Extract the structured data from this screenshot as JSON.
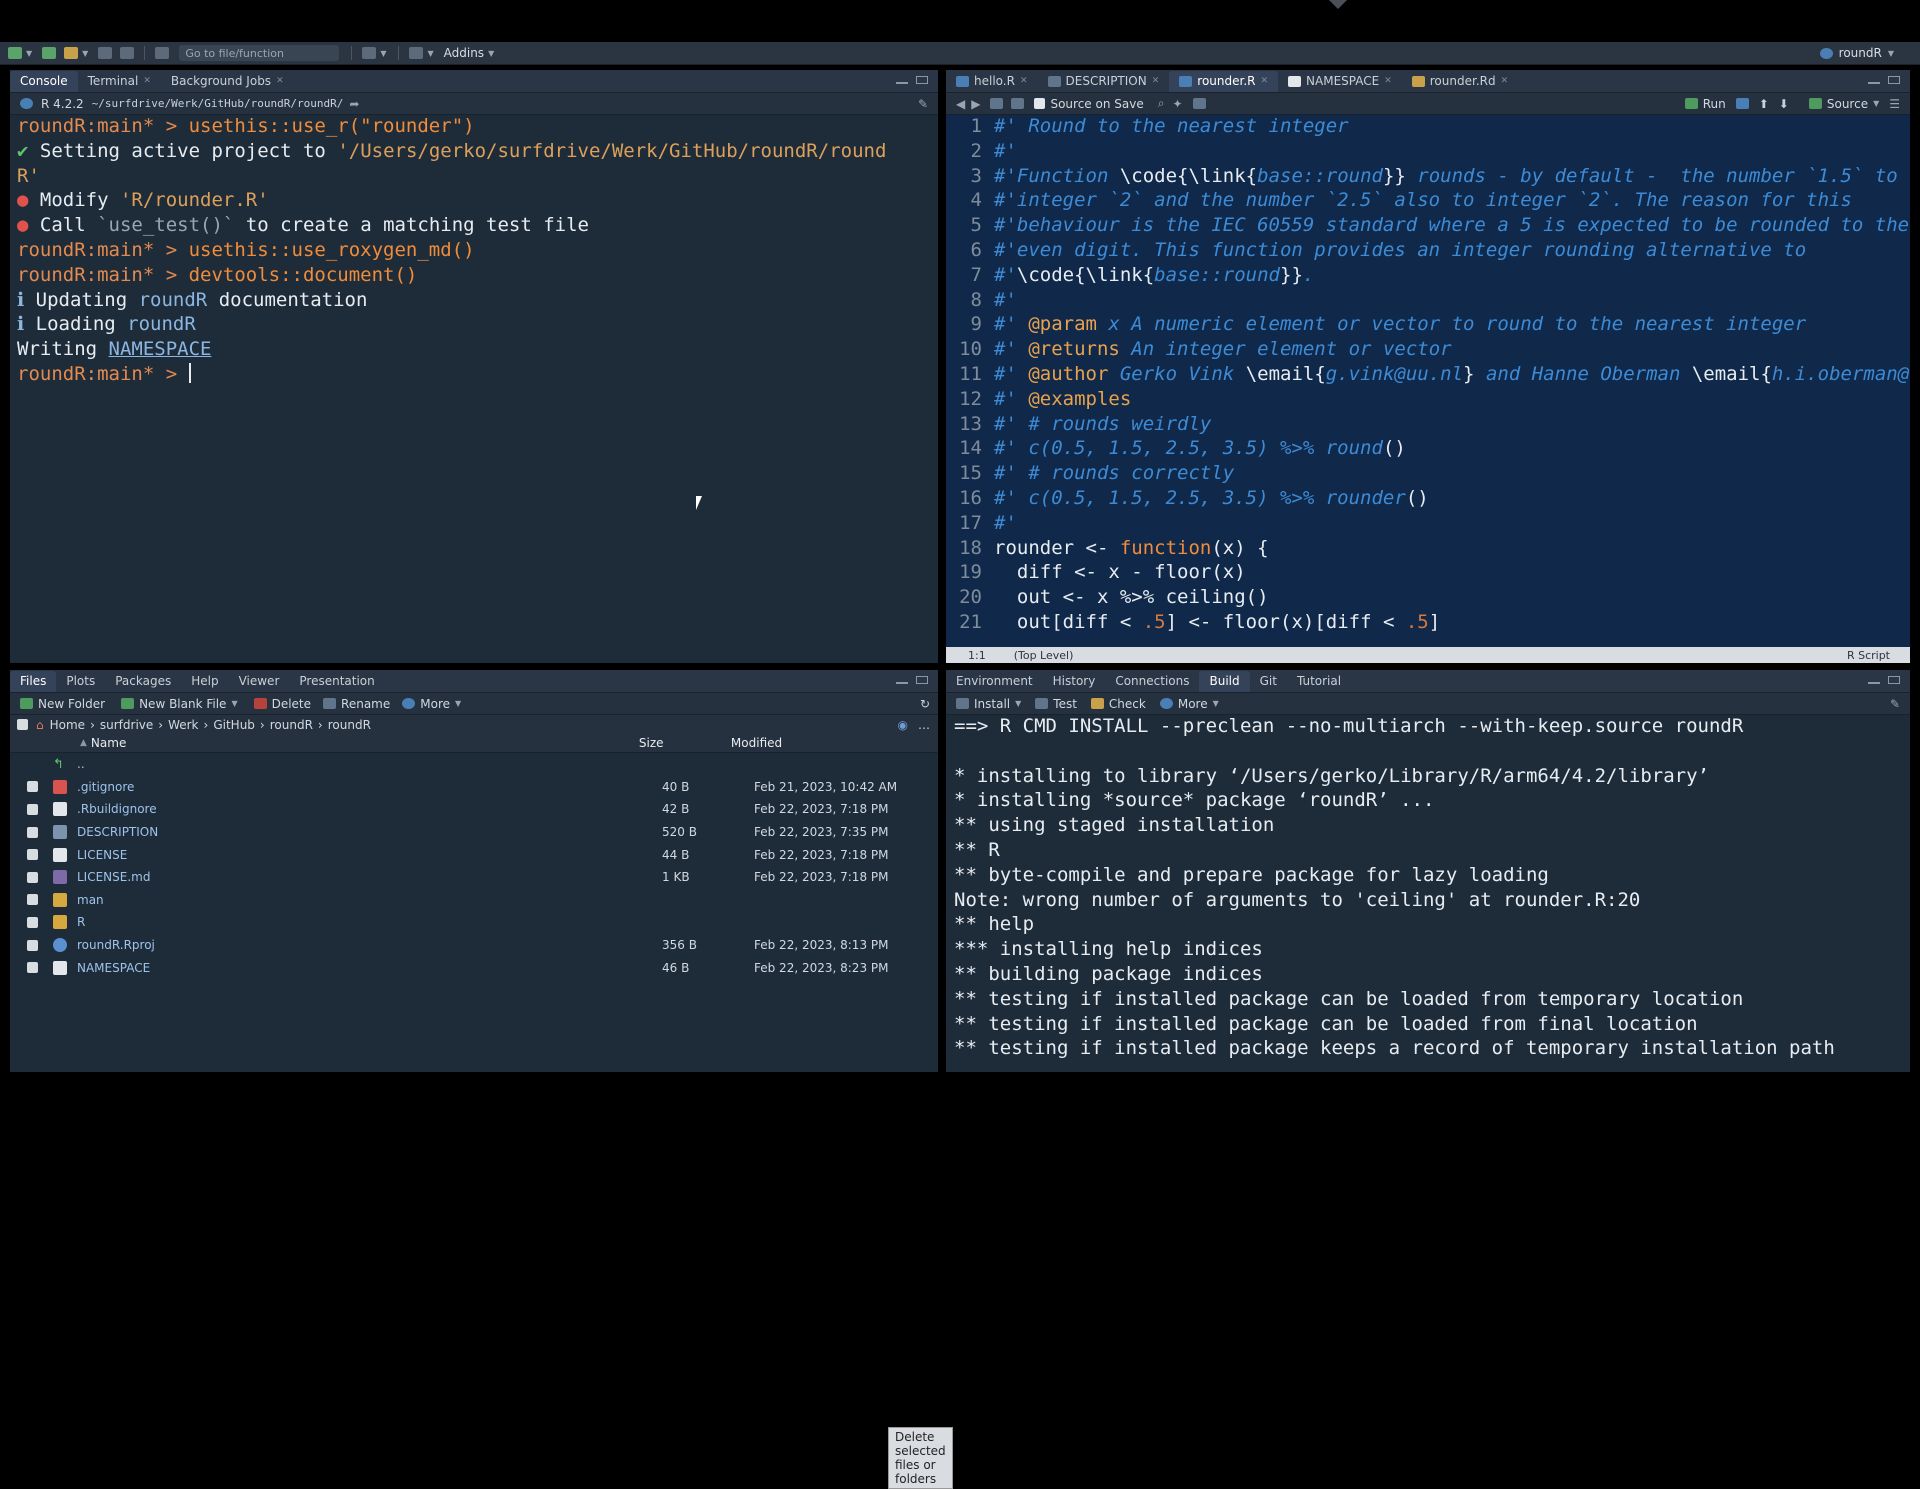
{
  "toolbar": {
    "goto_placeholder": "Go to file/function",
    "addins": "Addins",
    "project": "roundR"
  },
  "console": {
    "tabs": [
      "Console",
      "Terminal",
      "Background Jobs"
    ],
    "r_version": "R 4.2.2",
    "path": "~/surfdrive/Werk/GitHub/roundR/roundR/",
    "lines": {
      "l1_prompt": "roundR:main* > ",
      "l1_cmd": "usethis::use_r(\"rounder\")",
      "l2_mark": "✔",
      "l2_text": " Setting active project to ",
      "l2_path": "'/Users/gerko/surfdrive/Werk/GitHub/roundR/round",
      "l3_path": "R'",
      "l4_mark": "●",
      "l4_text": " Modify ",
      "l4_path": "'R/rounder.R'",
      "l5_mark": "●",
      "l5_text1": " Call ",
      "l5_code": "`use_test()`",
      "l5_text2": " to create a matching test file",
      "l6_prompt": "roundR:main* > ",
      "l6_cmd": "usethis::use_roxygen_md()",
      "l7_prompt": "roundR:main* > ",
      "l7_cmd": "devtools::document()",
      "l8_mark": "ℹ",
      "l8_text1": " Updating ",
      "l8_pkg": "roundR",
      "l8_text2": " documentation",
      "l9_mark": "ℹ",
      "l9_text1": " Loading ",
      "l9_pkg": "roundR",
      "l10_text": "Writing ",
      "l10_link": "NAMESPACE",
      "l11_prompt": "roundR:main* > "
    }
  },
  "editor": {
    "tabs": [
      "hello.R",
      "DESCRIPTION",
      "rounder.R",
      "NAMESPACE",
      "rounder.Rd"
    ],
    "toolbar": {
      "source_on_save": "Source on Save",
      "run": "Run",
      "source": "Source"
    },
    "status": {
      "pos": "1:1",
      "scope": "(Top Level)",
      "type": "R Script"
    },
    "lines": {
      "n": [
        "1",
        "2",
        "3",
        "4",
        "5",
        "6",
        "7",
        "8",
        "9",
        "10",
        "11",
        "12",
        "13",
        "14",
        "15",
        "16",
        "17",
        "18",
        "19",
        "20",
        "21"
      ],
      "l1": "#' Round to the nearest integer",
      "l2": "#'",
      "l3a": "#'Function ",
      "l3b": "\\code{\\link{",
      "l3c": "base::round",
      "l3d": "}}",
      "l3e": " rounds - by default -  the number `1.5` to",
      "l4": "#'integer `2` and the number `2.5` also to integer `2`. The reason for this",
      "l5": "#'behaviour is the IEC 60559 standard where a 5 is expected to be rounded to the",
      "l6": "#'even digit. This function provides an integer rounding alternative to",
      "l7a": "#'",
      "l7b": "\\code{\\link{",
      "l7c": "base::round",
      "l7d": "}}",
      "l7e": ".",
      "l8": "#'",
      "l9a": "#' ",
      "l9b": "@param",
      "l9c": " x A numeric element or vector to round to the nearest integer",
      "l10a": "#' ",
      "l10b": "@returns",
      "l10c": " An integer element or vector",
      "l11a": "#' ",
      "l11b": "@author",
      "l11c": " Gerko Vink ",
      "l11d": "\\email{",
      "l11e": "g.vink@uu.nl",
      "l11f": "}",
      "l11g": " and Hanne Oberman ",
      "l11h": "\\email{",
      "l11i": "h.i.oberman@uu.nl",
      "l12a": "#' ",
      "l12b": "@examples",
      "l13": "#' # rounds weirdly",
      "l14a": "#' c(0.5, 1.5, 2.5, 3.5) %>% round",
      "l14b": "()",
      "l15": "#' # rounds correctly",
      "l16a": "#' c(0.5, 1.5, 2.5, 3.5) %>% rounder",
      "l16b": "()",
      "l17": "#'",
      "l18a": "rounder <- ",
      "l18b": "function",
      "l18c": "(x) {",
      "l19": "  diff <- x - floor(x)",
      "l20": "  out <- x %>% ceiling()",
      "l21a": "  out[diff < ",
      "l21b": ".5",
      "l21c": "] <- floor(x)[diff < ",
      "l21d": ".5",
      "l21e": "]"
    }
  },
  "files": {
    "tabs": [
      "Files",
      "Plots",
      "Packages",
      "Help",
      "Viewer",
      "Presentation"
    ],
    "toolbar": {
      "new_folder": "New Folder",
      "new_blank_file": "New Blank File",
      "delete": "Delete",
      "rename": "Rename",
      "more": "More"
    },
    "breadcrumb": [
      "Home",
      "surfdrive",
      "Werk",
      "GitHub",
      "roundR",
      "roundR"
    ],
    "columns": {
      "name": "Name",
      "size": "Size",
      "modified": "Modified"
    },
    "up": "..",
    "rows": [
      {
        "name": ".gitignore",
        "size": "40 B",
        "modified": "Feb 21, 2023, 10:42 AM",
        "icon": "git"
      },
      {
        "name": ".Rbuildignore",
        "size": "42 B",
        "modified": "Feb 22, 2023, 7:18 PM",
        "icon": "file"
      },
      {
        "name": "DESCRIPTION",
        "size": "520 B",
        "modified": "Feb 22, 2023, 7:35 PM",
        "icon": "desc"
      },
      {
        "name": "LICENSE",
        "size": "44 B",
        "modified": "Feb 22, 2023, 7:18 PM",
        "icon": "file"
      },
      {
        "name": "LICENSE.md",
        "size": "1 KB",
        "modified": "Feb 22, 2023, 7:18 PM",
        "icon": "md"
      },
      {
        "name": "man",
        "size": "",
        "modified": "",
        "icon": "folder"
      },
      {
        "name": "R",
        "size": "",
        "modified": "",
        "icon": "folder"
      },
      {
        "name": "roundR.Rproj",
        "size": "356 B",
        "modified": "Feb 22, 2023, 8:13 PM",
        "icon": "proj"
      },
      {
        "name": "NAMESPACE",
        "size": "46 B",
        "modified": "Feb 22, 2023, 8:23 PM",
        "icon": "file"
      }
    ],
    "tooltip": "Delete selected files or folders"
  },
  "build": {
    "tabs": [
      "Environment",
      "History",
      "Connections",
      "Build",
      "Git",
      "Tutorial"
    ],
    "toolbar": {
      "install": "Install",
      "test": "Test",
      "check": "Check",
      "more": "More"
    },
    "lines": [
      "==> R CMD INSTALL --preclean --no-multiarch --with-keep.source roundR",
      "",
      "* installing to library ‘/Users/gerko/Library/R/arm64/4.2/library’",
      "* installing *source* package ‘roundR’ ...",
      "** using staged installation",
      "** R",
      "** byte-compile and prepare package for lazy loading",
      "Note: wrong number of arguments to 'ceiling' at rounder.R:20",
      "** help",
      "*** installing help indices",
      "** building package indices",
      "** testing if installed package can be loaded from temporary location",
      "** testing if installed package can be loaded from final location",
      "** testing if installed package keeps a record of temporary installation path"
    ]
  }
}
